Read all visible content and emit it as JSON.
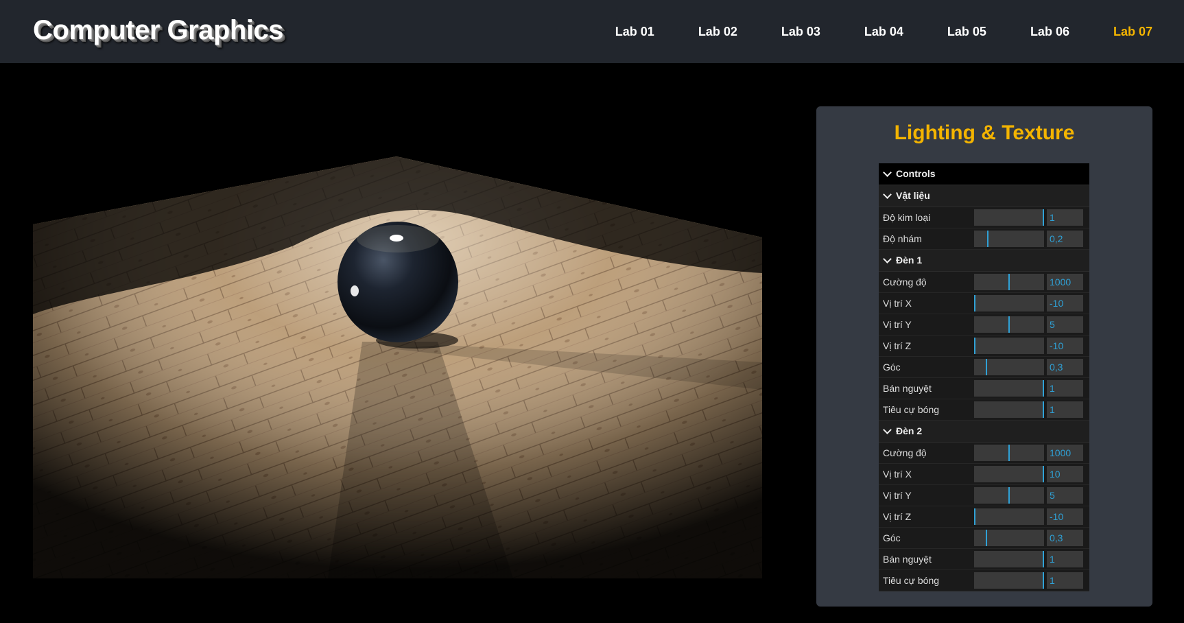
{
  "header": {
    "brand": "Computer Graphics",
    "nav": [
      "Lab 01",
      "Lab 02",
      "Lab 03",
      "Lab 04",
      "Lab 05",
      "Lab 06",
      "Lab 07"
    ],
    "active_index": 6
  },
  "colors": {
    "accent": "#f4b400",
    "header_bg": "#22262d",
    "panel_bg": "#353a43",
    "slider_fill": "#2fa1d6"
  },
  "panel": {
    "title": "Lighting & Texture",
    "gui": {
      "controls_label": "Controls",
      "material": {
        "title": "Vật liệu",
        "metalness": {
          "label": "Độ kim loại",
          "value": "1",
          "fraction": 1.0
        },
        "roughness": {
          "label": "Độ nhám",
          "value": "0,2",
          "fraction": 0.2
        }
      },
      "light1": {
        "title": "Đèn 1",
        "intensity": {
          "label": "Cường độ",
          "value": "1000",
          "fraction": 0.5
        },
        "pos_x": {
          "label": "Vị trí X",
          "value": "-10",
          "fraction": 0.0
        },
        "pos_y": {
          "label": "Vị trí Y",
          "value": "5",
          "fraction": 0.5
        },
        "pos_z": {
          "label": "Vị trí Z",
          "value": "-10",
          "fraction": 0.0
        },
        "angle": {
          "label": "Góc",
          "value": "0,3",
          "fraction": 0.18
        },
        "penumbra": {
          "label": "Bán nguyệt",
          "value": "1",
          "fraction": 1.0
        },
        "shadow_focus": {
          "label": "Tiêu cự bóng",
          "value": "1",
          "fraction": 1.0
        }
      },
      "light2": {
        "title": "Đèn 2",
        "intensity": {
          "label": "Cường độ",
          "value": "1000",
          "fraction": 0.5
        },
        "pos_x": {
          "label": "Vị trí X",
          "value": "10",
          "fraction": 1.0
        },
        "pos_y": {
          "label": "Vị trí Y",
          "value": "5",
          "fraction": 0.5
        },
        "pos_z": {
          "label": "Vị trí Z",
          "value": "-10",
          "fraction": 0.0
        },
        "angle": {
          "label": "Góc",
          "value": "0,3",
          "fraction": 0.18
        },
        "penumbra": {
          "label": "Bán nguyệt",
          "value": "1",
          "fraction": 1.0
        },
        "shadow_focus": {
          "label": "Tiêu cự bóng",
          "value": "1",
          "fraction": 1.0
        }
      }
    }
  }
}
